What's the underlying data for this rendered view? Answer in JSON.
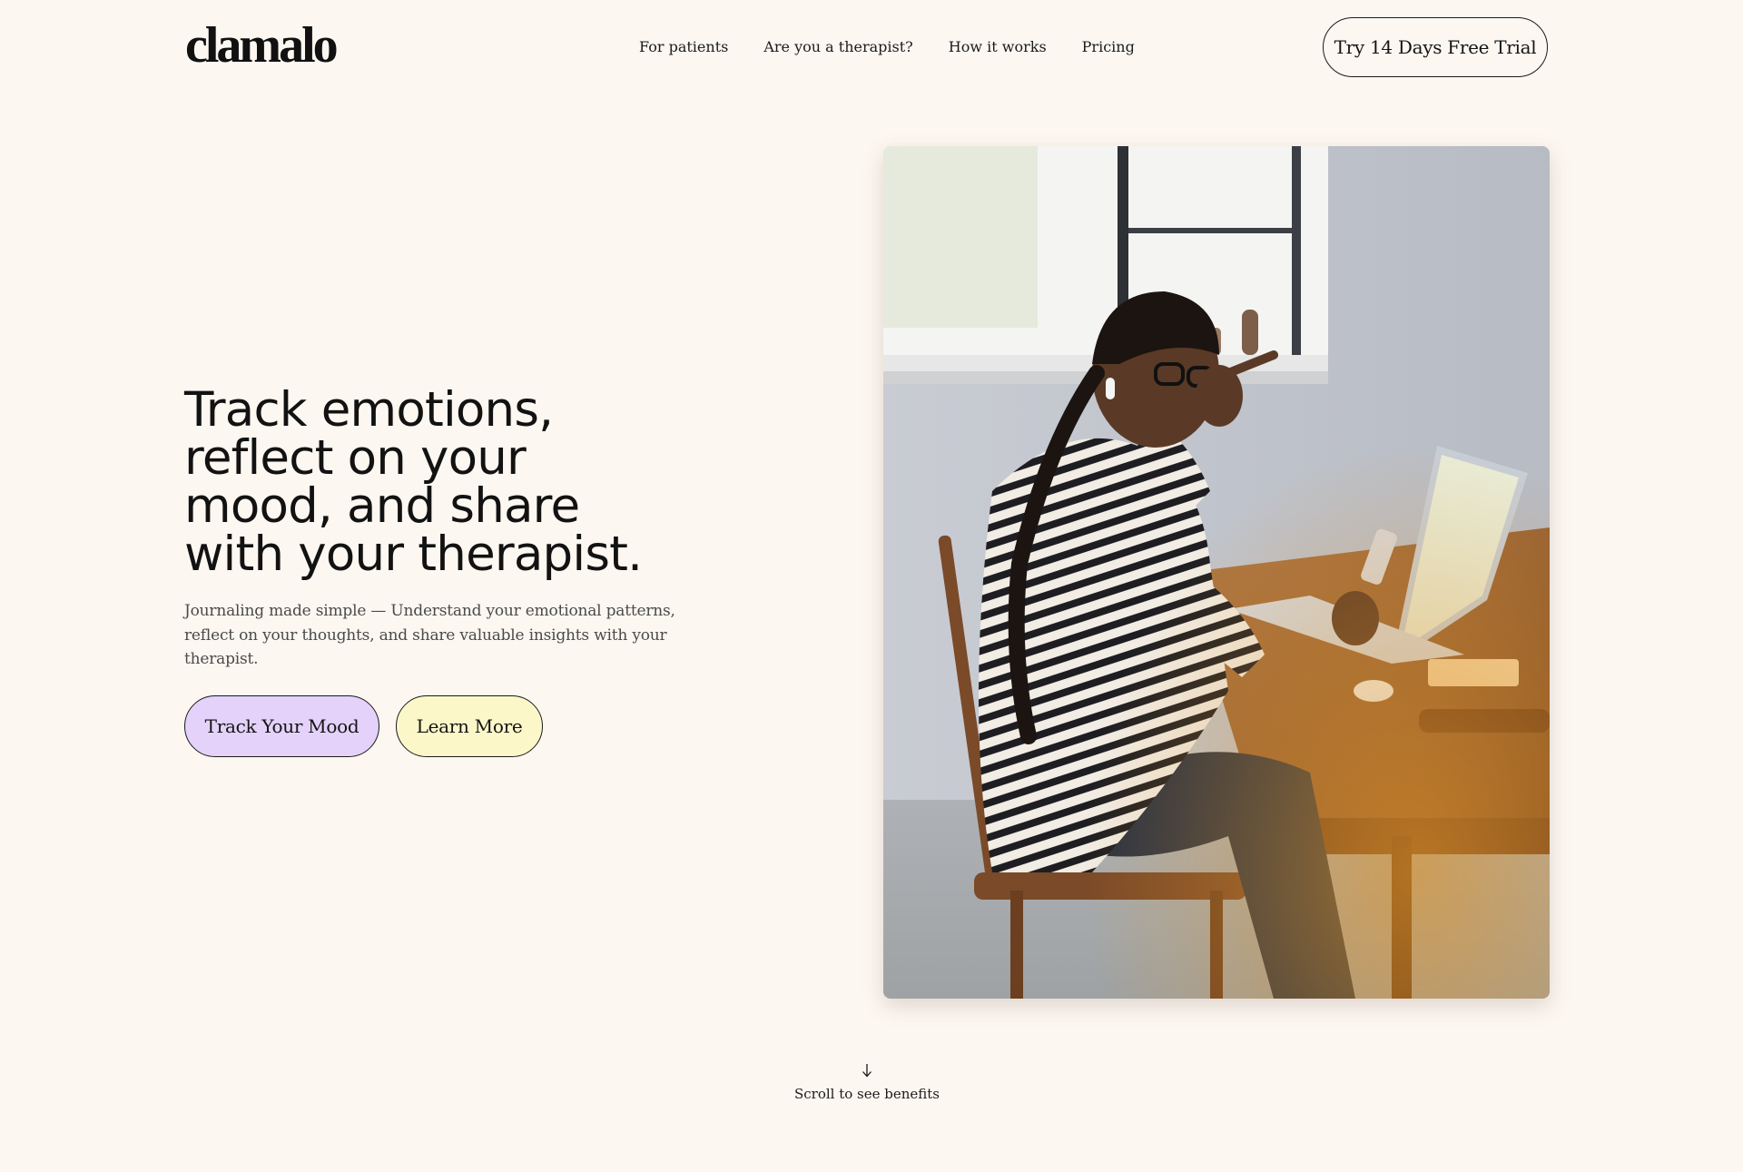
{
  "brand": {
    "logo_text": "clamalo"
  },
  "nav": {
    "items": [
      {
        "label": "For patients"
      },
      {
        "label": "Are you a therapist?"
      },
      {
        "label": "How it works"
      },
      {
        "label": "Pricing"
      }
    ],
    "cta_label": "Try 14 Days Free Trial"
  },
  "hero": {
    "title_lines": [
      "Track emotions,",
      "reflect on your",
      "mood, and share",
      "with your therapist."
    ],
    "subtitle": "Journaling made simple — Understand your emotional patterns, reflect on your thoughts, and share valuable insights with your therapist.",
    "primary_button": "Track Your Mood",
    "secondary_button": "Learn More"
  },
  "scroll_hint": {
    "icon": "arrow-down-icon",
    "label": "Scroll to see benefits"
  },
  "colors": {
    "background": "#fdf7f1",
    "primary_button_bg": "#e4d2fa",
    "secondary_button_bg": "#fcf7c9",
    "text": "#141414",
    "subtext": "#4a4a4a"
  }
}
